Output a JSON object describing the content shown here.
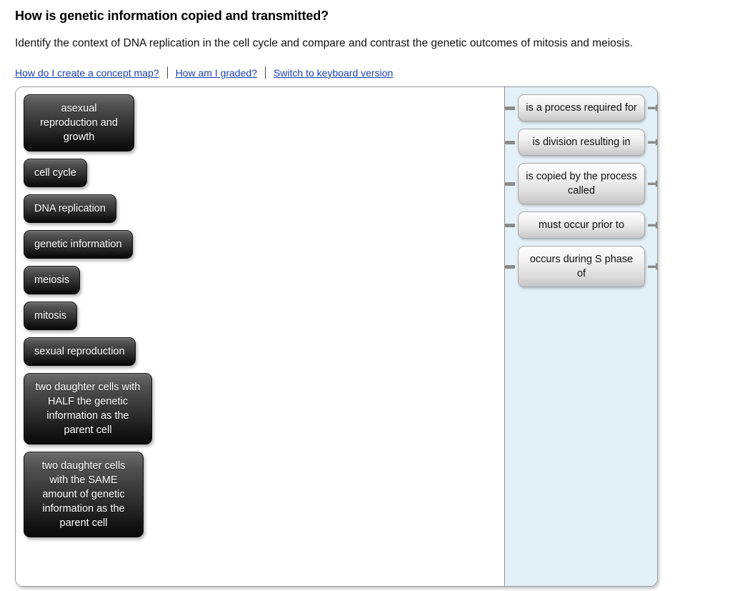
{
  "header": {
    "title": "How is genetic information copied and transmitted?",
    "subtitle": "Identify the context of DNA replication in the cell cycle and compare and contrast the genetic outcomes of mitosis and meiosis.",
    "links": [
      {
        "label": "How do I create a concept map?"
      },
      {
        "label": "How am I graded?"
      },
      {
        "label": "Switch to keyboard version"
      }
    ]
  },
  "concepts": [
    {
      "label": "asexual reproduction and growth"
    },
    {
      "label": "cell cycle"
    },
    {
      "label": "DNA replication"
    },
    {
      "label": "genetic information"
    },
    {
      "label": "meiosis"
    },
    {
      "label": "mitosis"
    },
    {
      "label": "sexual reproduction"
    },
    {
      "label": "two daughter cells with HALF the genetic information as the parent cell"
    },
    {
      "label": "two daughter cells with the SAME amount of genetic information as the parent cell"
    }
  ],
  "linking_phrases": [
    {
      "label": "is a process required for"
    },
    {
      "label": "is division resulting in"
    },
    {
      "label": "is copied by the process called"
    },
    {
      "label": "must occur prior to"
    },
    {
      "label": "occurs during S phase of"
    }
  ],
  "colors": {
    "link_text": "#1b3fae",
    "concept_box_text": "#ffffff",
    "link_panel_background": "#e4f0f7",
    "container_border": "#9a9a9a",
    "connector": "#8a8a8a"
  },
  "icons": {
    "arrow_right": "arrow-right-icon",
    "connector_stub": "connector-stub-icon"
  }
}
